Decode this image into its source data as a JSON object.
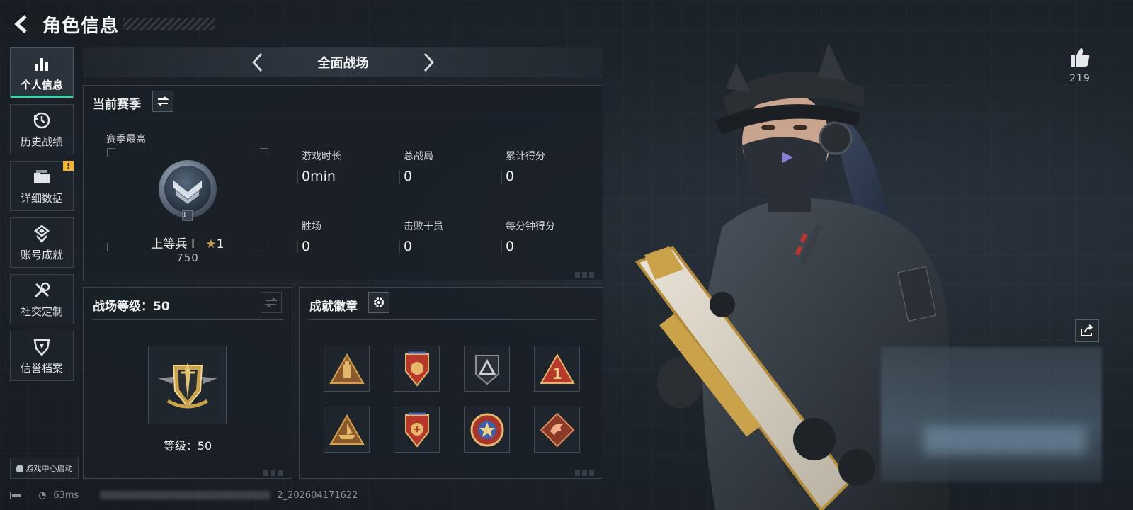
{
  "header": {
    "title": "角色信息"
  },
  "sidebar": {
    "items": [
      {
        "label": "个人信息",
        "icon": "bar-chart-icon",
        "active": true
      },
      {
        "label": "历史战绩",
        "icon": "history-icon"
      },
      {
        "label": "详细数据",
        "icon": "folder-icon",
        "badge": "!"
      },
      {
        "label": "账号成就",
        "icon": "achievement-icon"
      },
      {
        "label": "社交定制",
        "icon": "tools-icon"
      },
      {
        "label": "信誉档案",
        "icon": "reputation-icon"
      }
    ],
    "launch_label": "游戏中心启动"
  },
  "mode": {
    "title": "全面战场"
  },
  "season": {
    "title": "当前赛季",
    "best_label": "赛季最高",
    "rank_name": "上等兵 Ⅰ",
    "rank_stars": "1",
    "rank_points": "750",
    "rank_tier": "I",
    "stats": [
      {
        "label": "游戏时长",
        "value": "0min"
      },
      {
        "label": "总战局",
        "value": "0"
      },
      {
        "label": "累计得分",
        "value": "0"
      },
      {
        "label": "胜场",
        "value": "0"
      },
      {
        "label": "击败干员",
        "value": "0"
      },
      {
        "label": "每分钟得分",
        "value": "0"
      }
    ]
  },
  "battlefield": {
    "title": "战场等级：50",
    "level_label": "等级：50"
  },
  "achievements": {
    "title": "成就徽章",
    "badges": [
      "ammo-badge-icon",
      "shield-wing-badge-icon",
      "dark-triangle-badge-icon",
      "number-one-badge-icon",
      "boat-badge-icon",
      "shield-star-badge-icon",
      "round-star-badge-icon",
      "dragon-badge-icon"
    ]
  },
  "profile": {
    "likes": "219"
  },
  "status_bar": {
    "ping": "63ms",
    "build": "2_202604171622"
  },
  "colors": {
    "accent": "#3cd4a6",
    "badge_alert": "#f2b631",
    "gold": "#c9a24a"
  }
}
